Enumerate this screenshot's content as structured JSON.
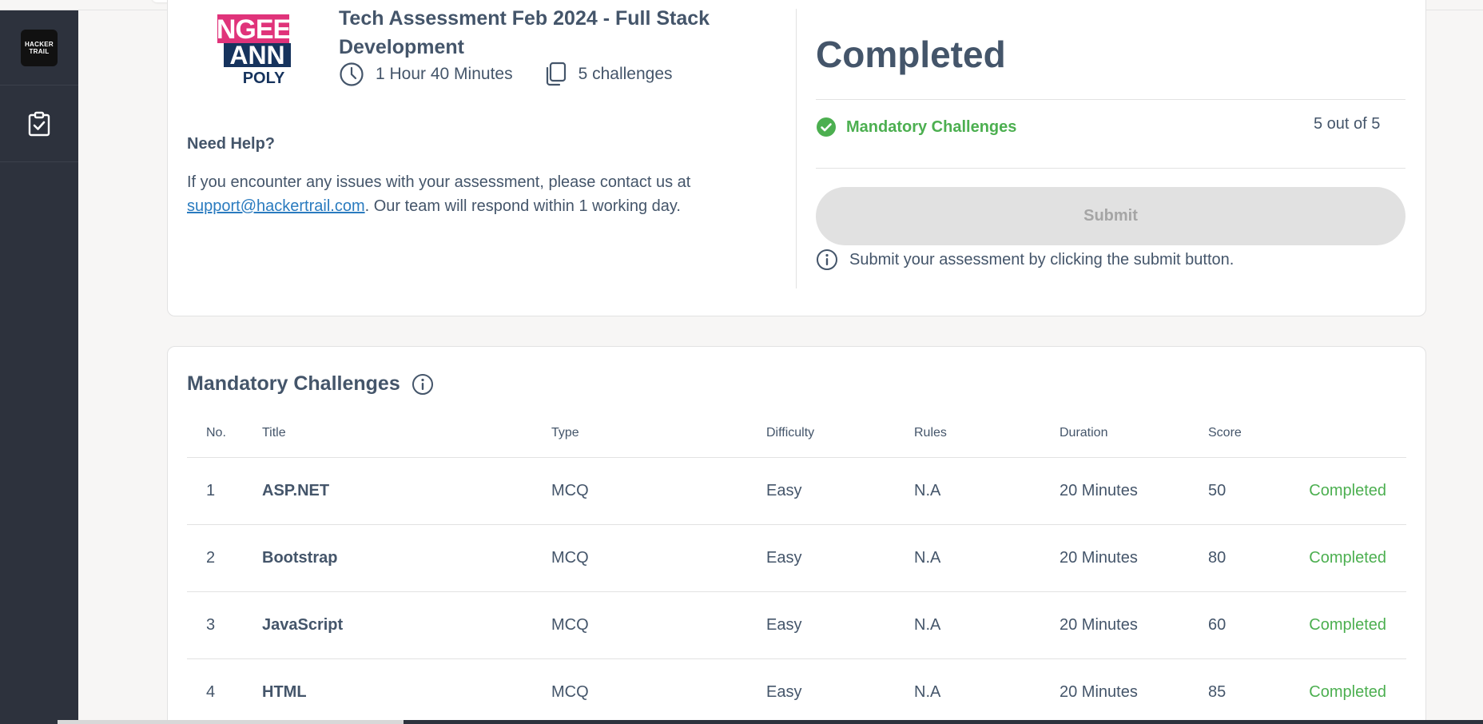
{
  "sidebar": {
    "logo_line1": "HACKER",
    "logo_line2": "TRAIL",
    "items": [
      {
        "icon": "clipboard-check-icon"
      }
    ]
  },
  "assessment": {
    "logo_text": [
      "NGEE",
      "ANN",
      "POLY"
    ],
    "title": "Tech Assessment Feb 2024 - Full Stack Development",
    "duration": "1 Hour 40 Minutes",
    "challenges_count": "5 challenges"
  },
  "help": {
    "heading": "Need Help?",
    "text_before": "If you encounter any issues with your assessment, please contact us at ",
    "email": "support@hackertrail.com",
    "text_after": ". Our team will respond within 1 working day."
  },
  "status_panel": {
    "status": "Completed",
    "mandatory_label": "Mandatory Challenges",
    "mandatory_count": "5 out of 5",
    "submit_label": "Submit",
    "submit_note": "Submit your assessment by clicking the submit button."
  },
  "challenges": {
    "title": "Mandatory Challenges",
    "columns": [
      "No.",
      "Title",
      "Type",
      "Difficulty",
      "Rules",
      "Duration",
      "Score",
      ""
    ],
    "rows": [
      [
        "1",
        "ASP.NET",
        "MCQ",
        "Easy",
        "N.A",
        "20 Minutes",
        "50",
        "Completed"
      ],
      [
        "2",
        "Bootstrap",
        "MCQ",
        "Easy",
        "N.A",
        "20 Minutes",
        "80",
        "Completed"
      ],
      [
        "3",
        "JavaScript",
        "MCQ",
        "Easy",
        "N.A",
        "20 Minutes",
        "60",
        "Completed"
      ],
      [
        "4",
        "HTML",
        "MCQ",
        "Easy",
        "N.A",
        "20 Minutes",
        "85",
        "Completed"
      ]
    ]
  },
  "colors": {
    "sidebar_bg": "#2d323d",
    "text": "#44556a",
    "success": "#4caf50",
    "link": "#2a7bbf",
    "disabled_button": "#e1e1e1"
  }
}
